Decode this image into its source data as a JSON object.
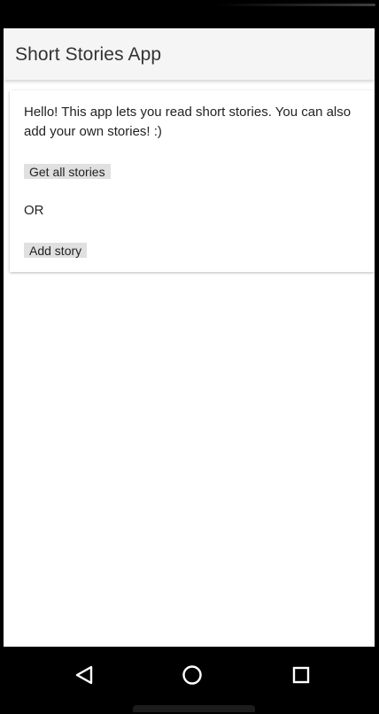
{
  "app_bar": {
    "title": "Short Stories App"
  },
  "card": {
    "intro_text": "Hello! This app lets you read short stories. You can also add your own stories! :)",
    "get_all_label": "Get all stories",
    "or_text": "OR",
    "add_label": "Add story"
  },
  "nav": {
    "back_icon": "back-triangle-icon",
    "home_icon": "home-circle-icon",
    "recents_icon": "recents-square-icon"
  },
  "colors": {
    "app_bar_bg": "#f5f5f5",
    "button_bg": "#e0e0e0",
    "text": "#222222",
    "system_bar": "#000000"
  }
}
